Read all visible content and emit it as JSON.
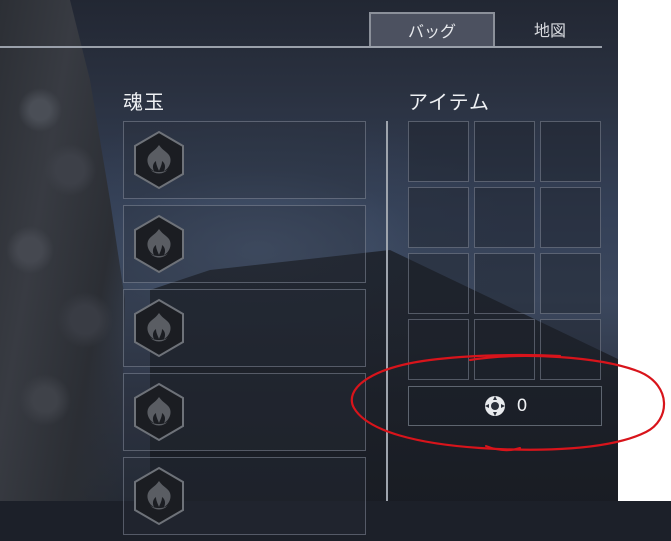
{
  "tabs": [
    {
      "label": "バッグ",
      "active": true
    },
    {
      "label": "地図",
      "active": false
    }
  ],
  "sections": {
    "soul_orbs": {
      "title": "魂玉"
    },
    "items": {
      "title": "アイテム"
    }
  },
  "soul_orb_slots": [
    {
      "icon": "soul-orb-icon"
    },
    {
      "icon": "soul-orb-icon"
    },
    {
      "icon": "soul-orb-icon"
    },
    {
      "icon": "soul-orb-icon"
    },
    {
      "icon": "soul-orb-icon"
    }
  ],
  "item_grid": {
    "columns": 3,
    "rows": 4,
    "items": []
  },
  "currency": {
    "icon": "sen-coin-icon",
    "amount": "0"
  },
  "colors": {
    "annotation": "#d8141b",
    "active_tab": "#4c5160",
    "text": "#eef0f3"
  }
}
